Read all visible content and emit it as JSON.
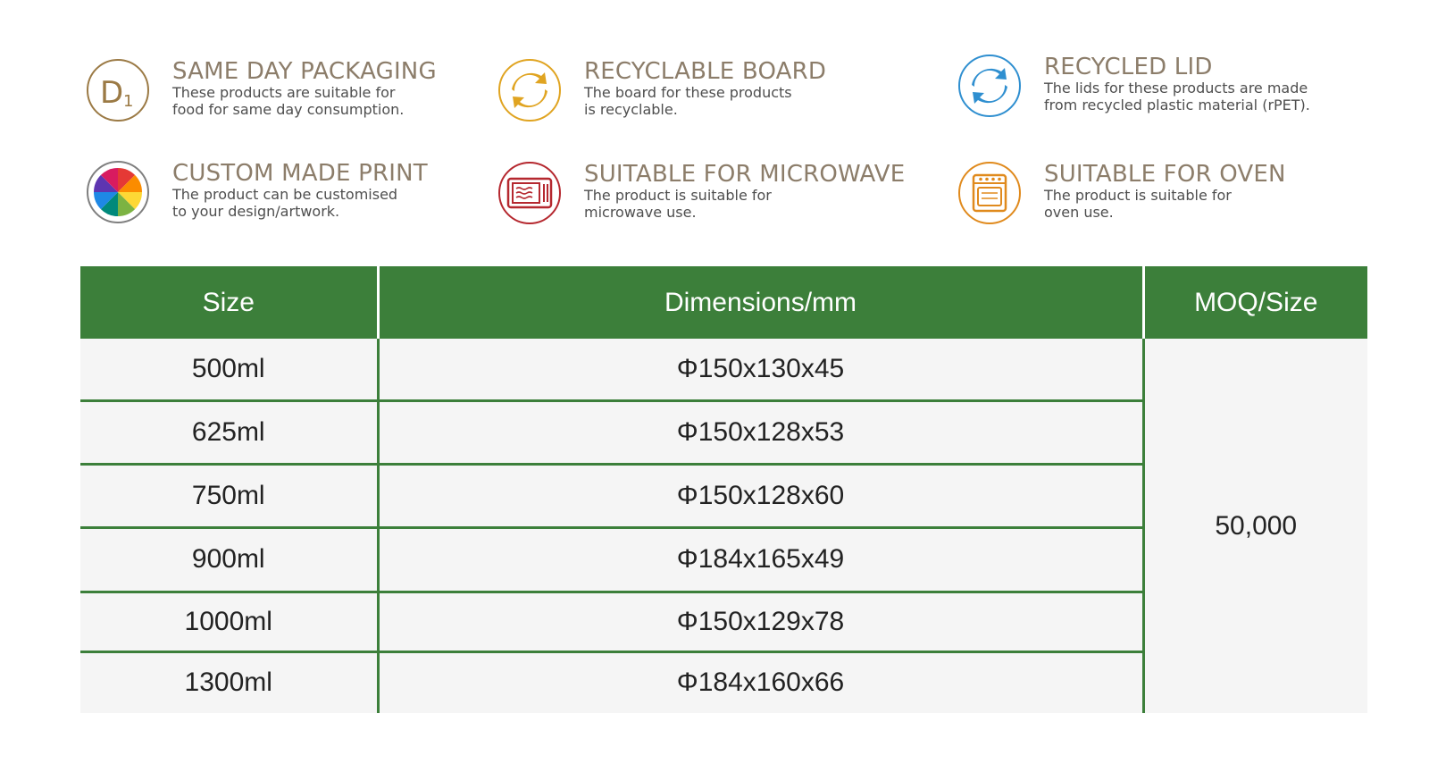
{
  "features": [
    {
      "title": "SAME DAY PACKAGING",
      "desc_lines": [
        "These products are suitable for",
        "food for same day consumption."
      ],
      "icon": "same-day-d1-icon",
      "color": "#9b7a45"
    },
    {
      "title": "RECYCLABLE BOARD",
      "desc_lines": [
        "The board for these products",
        "is recyclable."
      ],
      "icon": "recycle-arrows-icon",
      "color": "#e0a421"
    },
    {
      "title": "RECYCLED LID",
      "desc_lines": [
        "The lids for these products are made",
        "from recycled plastic material (rPET)."
      ],
      "icon": "recycle-arrows-icon",
      "color": "#2f8fd0"
    },
    {
      "title": "CUSTOM MADE PRINT",
      "desc_lines": [
        "The product can be customised",
        "to your design/artwork."
      ],
      "icon": "color-wheel-icon",
      "color": "#7f7f7f"
    },
    {
      "title": "SUITABLE FOR MICROWAVE",
      "desc_lines": [
        "The product is suitable for",
        "microwave use."
      ],
      "icon": "microwave-icon",
      "color": "#b5282f"
    },
    {
      "title": "SUITABLE FOR OVEN",
      "desc_lines": [
        "The product is suitable for",
        "oven use."
      ],
      "icon": "oven-icon",
      "color": "#e08a1d"
    }
  ],
  "table": {
    "headers": [
      "Size",
      "Dimensions/mm",
      "MOQ/Size"
    ],
    "rows": [
      {
        "size": "500ml",
        "dimensions": "Φ150x130x45"
      },
      {
        "size": "625ml",
        "dimensions": "Φ150x128x53"
      },
      {
        "size": "750ml",
        "dimensions": "Φ150x128x60"
      },
      {
        "size": "900ml",
        "dimensions": "Φ184x165x49"
      },
      {
        "size": "1000ml",
        "dimensions": "Φ150x129x78"
      },
      {
        "size": "1300ml",
        "dimensions": "Φ184x160x66"
      }
    ],
    "moq": "50,000",
    "header_color": "#3c7f3a"
  }
}
